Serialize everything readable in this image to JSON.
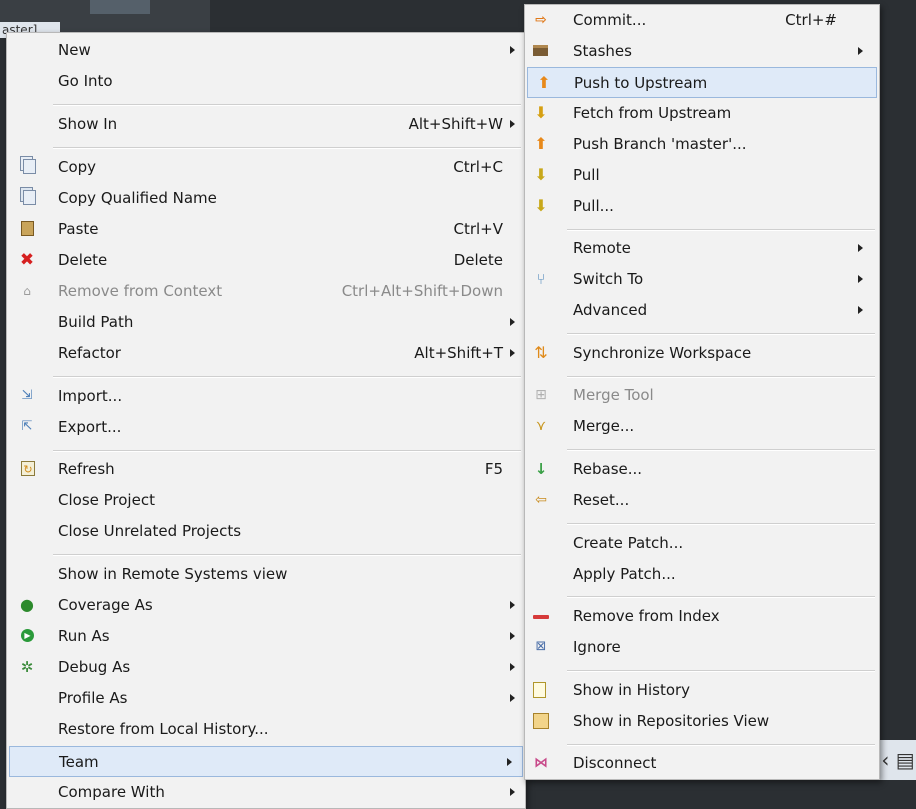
{
  "background": {
    "tab_label": "aster]",
    "right_icon": "‹ ▤"
  },
  "main_menu": {
    "items": [
      {
        "label": "New",
        "accel": "",
        "submenu": true
      },
      {
        "label": "Go Into",
        "accel": "",
        "submenu": false
      },
      {
        "label": "Show In",
        "accel": "Alt+Shift+W",
        "submenu": true
      },
      {
        "label": "Copy",
        "accel": "Ctrl+C",
        "submenu": false,
        "icon": "copy-icon"
      },
      {
        "label": "Copy Qualified Name",
        "accel": "",
        "submenu": false,
        "icon": "copy-qualified-name-icon"
      },
      {
        "label": "Paste",
        "accel": "Ctrl+V",
        "submenu": false,
        "icon": "paste-icon"
      },
      {
        "label": "Delete",
        "accel": "Delete",
        "submenu": false,
        "icon": "delete-icon"
      },
      {
        "label": "Remove from Context",
        "accel": "Ctrl+Alt+Shift+Down",
        "submenu": false,
        "icon": "remove-context-icon",
        "disabled": true
      },
      {
        "label": "Build Path",
        "accel": "",
        "submenu": true
      },
      {
        "label": "Refactor",
        "accel": "Alt+Shift+T",
        "submenu": true
      },
      {
        "label": "Import...",
        "accel": "",
        "submenu": false,
        "icon": "import-icon"
      },
      {
        "label": "Export...",
        "accel": "",
        "submenu": false,
        "icon": "export-icon"
      },
      {
        "label": "Refresh",
        "accel": "F5",
        "submenu": false,
        "icon": "refresh-icon"
      },
      {
        "label": "Close Project",
        "accel": "",
        "submenu": false
      },
      {
        "label": "Close Unrelated Projects",
        "accel": "",
        "submenu": false
      },
      {
        "label": "Show in Remote Systems view",
        "accel": "",
        "submenu": false
      },
      {
        "label": "Coverage As",
        "accel": "",
        "submenu": true,
        "icon": "coverage-icon"
      },
      {
        "label": "Run As",
        "accel": "",
        "submenu": true,
        "icon": "run-icon"
      },
      {
        "label": "Debug As",
        "accel": "",
        "submenu": true,
        "icon": "debug-icon"
      },
      {
        "label": "Profile As",
        "accel": "",
        "submenu": true
      },
      {
        "label": "Restore from Local History...",
        "accel": "",
        "submenu": false
      },
      {
        "label": "Team",
        "accel": "",
        "submenu": true,
        "highlighted": true
      },
      {
        "label": "Compare With",
        "accel": "",
        "submenu": true
      }
    ]
  },
  "team_menu": {
    "items": [
      {
        "label": "Commit...",
        "accel": "Ctrl+#",
        "submenu": false,
        "icon": "commit-icon"
      },
      {
        "label": "Stashes",
        "accel": "",
        "submenu": true,
        "icon": "stashes-icon"
      },
      {
        "label": "Push to Upstream",
        "accel": "",
        "submenu": false,
        "icon": "push-upstream-icon",
        "highlighted": true
      },
      {
        "label": "Fetch from Upstream",
        "accel": "",
        "submenu": false,
        "icon": "fetch-upstream-icon"
      },
      {
        "label": "Push Branch 'master'...",
        "accel": "",
        "submenu": false,
        "icon": "push-branch-icon"
      },
      {
        "label": "Pull",
        "accel": "",
        "submenu": false,
        "icon": "pull-icon"
      },
      {
        "label": "Pull...",
        "accel": "",
        "submenu": false,
        "icon": "pull-dialog-icon"
      },
      {
        "label": "Remote",
        "accel": "",
        "submenu": true
      },
      {
        "label": "Switch To",
        "accel": "",
        "submenu": true,
        "icon": "switch-to-icon"
      },
      {
        "label": "Advanced",
        "accel": "",
        "submenu": true
      },
      {
        "label": "Synchronize Workspace",
        "accel": "",
        "submenu": false,
        "icon": "synchronize-icon"
      },
      {
        "label": "Merge Tool",
        "accel": "",
        "submenu": false,
        "icon": "merge-tool-icon",
        "disabled": true
      },
      {
        "label": "Merge...",
        "accel": "",
        "submenu": false,
        "icon": "merge-icon"
      },
      {
        "label": "Rebase...",
        "accel": "",
        "submenu": false,
        "icon": "rebase-icon"
      },
      {
        "label": "Reset...",
        "accel": "",
        "submenu": false,
        "icon": "reset-icon"
      },
      {
        "label": "Create Patch...",
        "accel": "",
        "submenu": false
      },
      {
        "label": "Apply Patch...",
        "accel": "",
        "submenu": false
      },
      {
        "label": "Remove from Index",
        "accel": "",
        "submenu": false,
        "icon": "remove-index-icon"
      },
      {
        "label": "Ignore",
        "accel": "",
        "submenu": false,
        "icon": "ignore-icon"
      },
      {
        "label": "Show in History",
        "accel": "",
        "submenu": false,
        "icon": "history-icon"
      },
      {
        "label": "Show in Repositories View",
        "accel": "",
        "submenu": false,
        "icon": "repositories-icon"
      },
      {
        "label": "Disconnect",
        "accel": "",
        "submenu": false,
        "icon": "disconnect-icon"
      }
    ]
  }
}
